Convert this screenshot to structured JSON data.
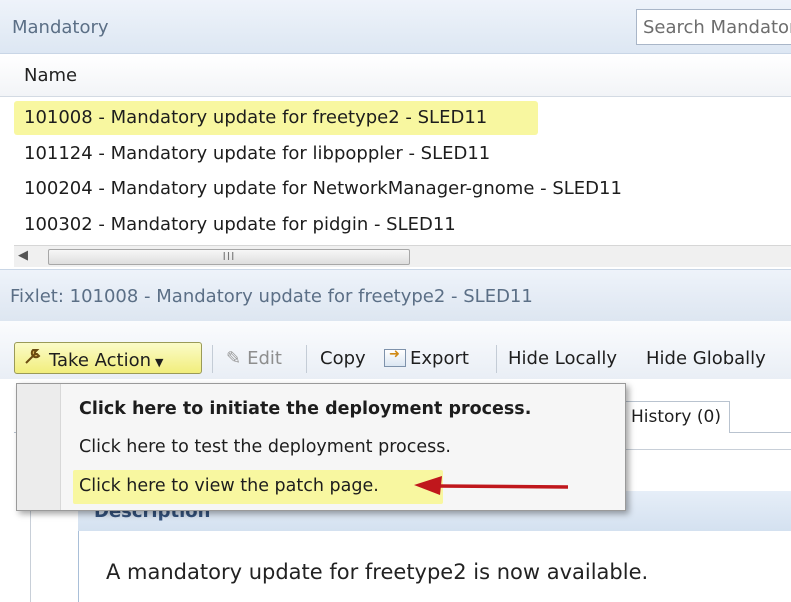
{
  "header": {
    "title": "Mandatory",
    "search_placeholder": "Search Mandatory"
  },
  "list": {
    "column_header": "Name",
    "rows": [
      "101008 - Mandatory update for freetype2 - SLED11",
      "101124 - Mandatory update for libpoppler - SLED11",
      "100204 - Mandatory update for NetworkManager-gnome - SLED11",
      "100302 - Mandatory update for pidgin - SLED11"
    ],
    "scroll_thumb_grip": "III"
  },
  "fixlet": {
    "title": "Fixlet: 101008 - Mandatory update for freetype2 - SLED11"
  },
  "toolbar": {
    "take_action": "Take Action",
    "edit": "Edit",
    "copy": "Copy",
    "export": "Export",
    "hide_locally": "Hide Locally",
    "hide_globally": "Hide Globally"
  },
  "menu": {
    "items": [
      "Click here to initiate the deployment process.",
      "Click here to test the deployment process.",
      "Click here to view the patch page."
    ]
  },
  "tabs": {
    "history": "History (0)"
  },
  "description": {
    "heading": "Description",
    "text": "A mandatory update for freetype2 is now available."
  },
  "colors": {
    "highlight": "#f8f7a0",
    "header_text": "#5b6f86",
    "annotation_arrow": "#c0171c"
  }
}
